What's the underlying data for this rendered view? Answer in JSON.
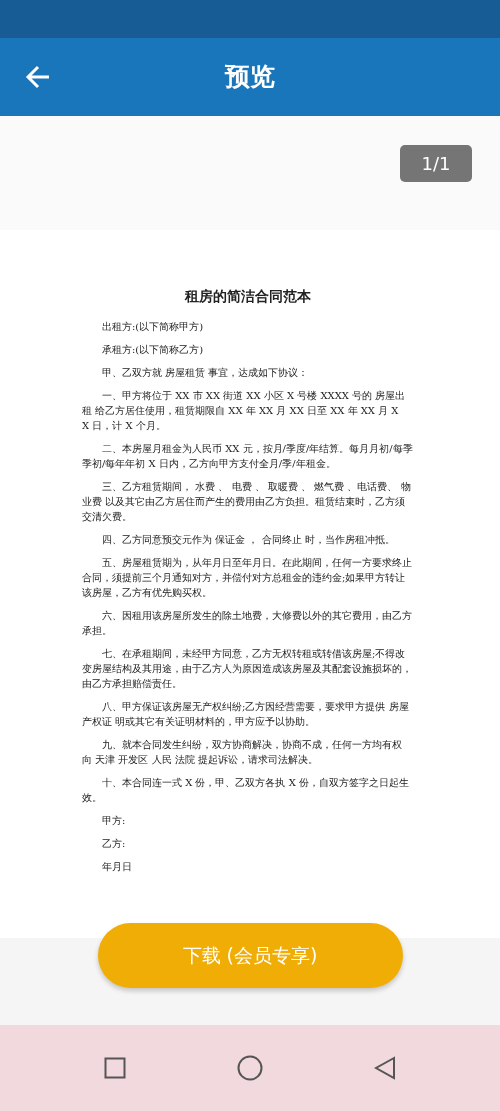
{
  "header": {
    "title": "预览"
  },
  "page_indicator": "1/1",
  "document": {
    "title": "租房的简洁合同范本",
    "paragraphs": [
      "出租方:(以下简称甲方)",
      "承租方:(以下简称乙方)",
      "甲、乙双方就 房屋租赁 事宜，达成如下协议：",
      "一、甲方将位于 XX 市 XX 街道 XX 小区 X 号楼 XXXX 号的 房屋出租 给乙方居住使用，租赁期限自 XX 年 XX 月 XX 日至 XX 年 XX 月 XX 日，计 X 个月。",
      "二、本房屋月租金为人民币 XX 元，按月/季度/年结算。每月月初/每季季初/每年年初 X 日内，乙方向甲方支付全月/季/年租金。",
      "三、乙方租赁期间， 水费 、 电费 、 取暖费 、 燃气费 、电话费、 物业费 以及其它由乙方居住而产生的费用由乙方负担。租赁结束时，乙方须交清欠费。",
      "四、乙方同意预交元作为 保证金 ， 合同终止 时，当作房租冲抵。",
      "五、房屋租赁期为，从年月日至年月日。在此期间，任何一方要求终止合同，须提前三个月通知对方，并偿付对方总租金的违约金;如果甲方转让该房屋，乙方有优先购买权。",
      "六、因租用该房屋所发生的除土地费，大修费以外的其它费用，由乙方承担。",
      "七、在承租期间，未经甲方同意，乙方无权转租或转借该房屋;不得改变房屋结构及其用途，由于乙方人为原因造成该房屋及其配套设施损坏的，由乙方承担赔偿责任。",
      "八、甲方保证该房屋无产权纠纷;乙方因经营需要，要求甲方提供 房屋产权证 明或其它有关证明材料的，甲方应予以协助。",
      "九、就本合同发生纠纷，双方协商解决，协商不成，任何一方均有权向 天津 开发区 人民 法院 提起诉讼，请求司法解决。",
      "十、本合同连一式 X 份，甲、乙双方各执 X 份，自双方签字之日起生效。",
      "甲方:",
      "乙方:",
      "年月日"
    ]
  },
  "download_button": {
    "label": "下载 (会员专享)"
  }
}
